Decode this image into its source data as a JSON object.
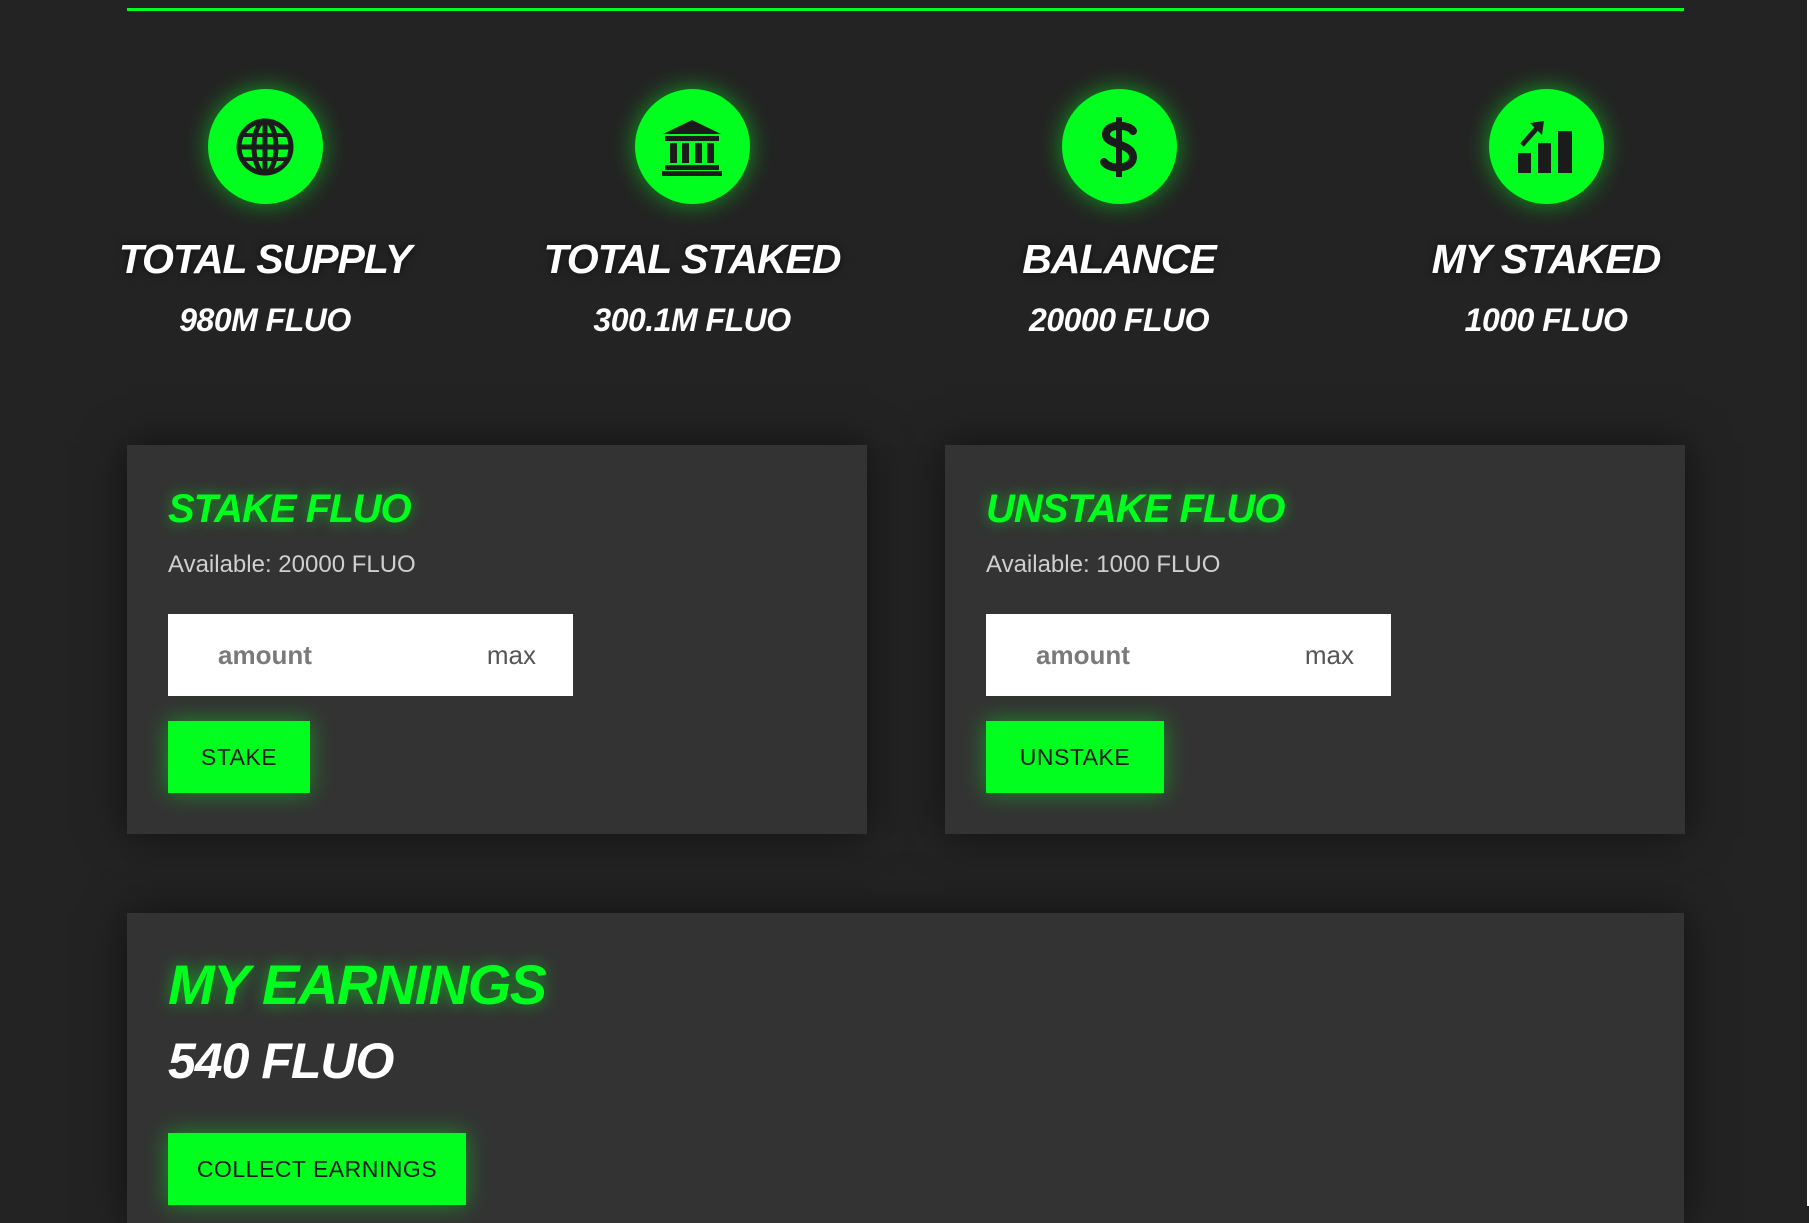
{
  "accent_color": "#00ff1e",
  "stats": [
    {
      "icon": "globe-icon",
      "label": "TOTAL SUPPLY",
      "value": "980M FLUO"
    },
    {
      "icon": "bank-icon",
      "label": "TOTAL STAKED",
      "value": "300.1M FLUO"
    },
    {
      "icon": "dollar-icon",
      "label": "BALANCE",
      "value": "20000 FLUO"
    },
    {
      "icon": "chart-icon",
      "label": "MY STAKED",
      "value": "1000 FLUO"
    }
  ],
  "stake": {
    "title": "STAKE FLUO",
    "available": "Available: 20000 FLUO",
    "placeholder": "amount",
    "max_label": "max",
    "button_label": "STAKE"
  },
  "unstake": {
    "title": "UNSTAKE FLUO",
    "available": "Available: 1000 FLUO",
    "placeholder": "amount",
    "max_label": "max",
    "button_label": "UNSTAKE"
  },
  "earnings": {
    "title": "MY EARNINGS",
    "value": "540 FLUO",
    "button_label": "COLLECT EARNINGS"
  }
}
